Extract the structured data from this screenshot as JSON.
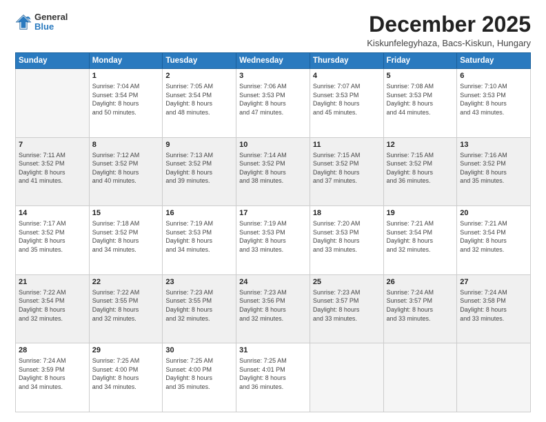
{
  "logo": {
    "general": "General",
    "blue": "Blue"
  },
  "header": {
    "month": "December 2025",
    "location": "Kiskunfelegyhaza, Bacs-Kiskun, Hungary"
  },
  "days": [
    "Sunday",
    "Monday",
    "Tuesday",
    "Wednesday",
    "Thursday",
    "Friday",
    "Saturday"
  ],
  "weeks": [
    [
      {
        "num": "",
        "info": ""
      },
      {
        "num": "1",
        "info": "Sunrise: 7:04 AM\nSunset: 3:54 PM\nDaylight: 8 hours\nand 50 minutes."
      },
      {
        "num": "2",
        "info": "Sunrise: 7:05 AM\nSunset: 3:54 PM\nDaylight: 8 hours\nand 48 minutes."
      },
      {
        "num": "3",
        "info": "Sunrise: 7:06 AM\nSunset: 3:53 PM\nDaylight: 8 hours\nand 47 minutes."
      },
      {
        "num": "4",
        "info": "Sunrise: 7:07 AM\nSunset: 3:53 PM\nDaylight: 8 hours\nand 45 minutes."
      },
      {
        "num": "5",
        "info": "Sunrise: 7:08 AM\nSunset: 3:53 PM\nDaylight: 8 hours\nand 44 minutes."
      },
      {
        "num": "6",
        "info": "Sunrise: 7:10 AM\nSunset: 3:53 PM\nDaylight: 8 hours\nand 43 minutes."
      }
    ],
    [
      {
        "num": "7",
        "info": "Sunrise: 7:11 AM\nSunset: 3:52 PM\nDaylight: 8 hours\nand 41 minutes."
      },
      {
        "num": "8",
        "info": "Sunrise: 7:12 AM\nSunset: 3:52 PM\nDaylight: 8 hours\nand 40 minutes."
      },
      {
        "num": "9",
        "info": "Sunrise: 7:13 AM\nSunset: 3:52 PM\nDaylight: 8 hours\nand 39 minutes."
      },
      {
        "num": "10",
        "info": "Sunrise: 7:14 AM\nSunset: 3:52 PM\nDaylight: 8 hours\nand 38 minutes."
      },
      {
        "num": "11",
        "info": "Sunrise: 7:15 AM\nSunset: 3:52 PM\nDaylight: 8 hours\nand 37 minutes."
      },
      {
        "num": "12",
        "info": "Sunrise: 7:15 AM\nSunset: 3:52 PM\nDaylight: 8 hours\nand 36 minutes."
      },
      {
        "num": "13",
        "info": "Sunrise: 7:16 AM\nSunset: 3:52 PM\nDaylight: 8 hours\nand 35 minutes."
      }
    ],
    [
      {
        "num": "14",
        "info": "Sunrise: 7:17 AM\nSunset: 3:52 PM\nDaylight: 8 hours\nand 35 minutes."
      },
      {
        "num": "15",
        "info": "Sunrise: 7:18 AM\nSunset: 3:52 PM\nDaylight: 8 hours\nand 34 minutes."
      },
      {
        "num": "16",
        "info": "Sunrise: 7:19 AM\nSunset: 3:53 PM\nDaylight: 8 hours\nand 34 minutes."
      },
      {
        "num": "17",
        "info": "Sunrise: 7:19 AM\nSunset: 3:53 PM\nDaylight: 8 hours\nand 33 minutes."
      },
      {
        "num": "18",
        "info": "Sunrise: 7:20 AM\nSunset: 3:53 PM\nDaylight: 8 hours\nand 33 minutes."
      },
      {
        "num": "19",
        "info": "Sunrise: 7:21 AM\nSunset: 3:54 PM\nDaylight: 8 hours\nand 32 minutes."
      },
      {
        "num": "20",
        "info": "Sunrise: 7:21 AM\nSunset: 3:54 PM\nDaylight: 8 hours\nand 32 minutes."
      }
    ],
    [
      {
        "num": "21",
        "info": "Sunrise: 7:22 AM\nSunset: 3:54 PM\nDaylight: 8 hours\nand 32 minutes."
      },
      {
        "num": "22",
        "info": "Sunrise: 7:22 AM\nSunset: 3:55 PM\nDaylight: 8 hours\nand 32 minutes."
      },
      {
        "num": "23",
        "info": "Sunrise: 7:23 AM\nSunset: 3:55 PM\nDaylight: 8 hours\nand 32 minutes."
      },
      {
        "num": "24",
        "info": "Sunrise: 7:23 AM\nSunset: 3:56 PM\nDaylight: 8 hours\nand 32 minutes."
      },
      {
        "num": "25",
        "info": "Sunrise: 7:23 AM\nSunset: 3:57 PM\nDaylight: 8 hours\nand 33 minutes."
      },
      {
        "num": "26",
        "info": "Sunrise: 7:24 AM\nSunset: 3:57 PM\nDaylight: 8 hours\nand 33 minutes."
      },
      {
        "num": "27",
        "info": "Sunrise: 7:24 AM\nSunset: 3:58 PM\nDaylight: 8 hours\nand 33 minutes."
      }
    ],
    [
      {
        "num": "28",
        "info": "Sunrise: 7:24 AM\nSunset: 3:59 PM\nDaylight: 8 hours\nand 34 minutes."
      },
      {
        "num": "29",
        "info": "Sunrise: 7:25 AM\nSunset: 4:00 PM\nDaylight: 8 hours\nand 34 minutes."
      },
      {
        "num": "30",
        "info": "Sunrise: 7:25 AM\nSunset: 4:00 PM\nDaylight: 8 hours\nand 35 minutes."
      },
      {
        "num": "31",
        "info": "Sunrise: 7:25 AM\nSunset: 4:01 PM\nDaylight: 8 hours\nand 36 minutes."
      },
      {
        "num": "",
        "info": ""
      },
      {
        "num": "",
        "info": ""
      },
      {
        "num": "",
        "info": ""
      }
    ]
  ]
}
